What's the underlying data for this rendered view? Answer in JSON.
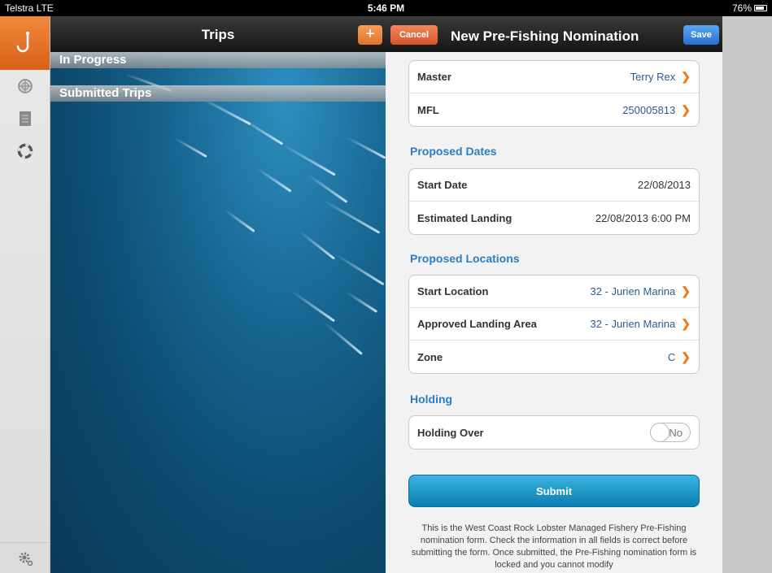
{
  "status_bar": {
    "carrier": "Telstra  LTE",
    "time": "5:46 PM",
    "battery": "76%"
  },
  "rail": {
    "items": [
      {
        "icon": "hook-icon"
      },
      {
        "icon": "radar-icon"
      },
      {
        "icon": "document-icon"
      },
      {
        "icon": "lifebuoy-icon"
      }
    ],
    "settings_icon": "gear-icon"
  },
  "trips_panel": {
    "title": "Trips",
    "add_label": "+",
    "sections": [
      "In Progress",
      "Submitted Trips"
    ]
  },
  "form_panel": {
    "cancel_label": "Cancel",
    "title": "New Pre-Fishing Nomination",
    "save_label": "Save",
    "vessel_rows": [
      {
        "label": "Master",
        "value": "Terry Rex"
      },
      {
        "label": "MFL",
        "value": "250005813"
      }
    ],
    "proposed_dates": {
      "title": "Proposed Dates",
      "rows": [
        {
          "label": "Start Date",
          "value": "22/08/2013"
        },
        {
          "label": "Estimated Landing",
          "value": "22/08/2013 6:00 PM"
        }
      ]
    },
    "proposed_locations": {
      "title": "Proposed Locations",
      "rows": [
        {
          "label": "Start Location",
          "value": "32 - Jurien Marina"
        },
        {
          "label": "Approved Landing Area",
          "value": "32 - Jurien Marina"
        },
        {
          "label": "Zone",
          "value": "C"
        }
      ]
    },
    "holding": {
      "title": "Holding",
      "label": "Holding Over",
      "toggle_value": "No"
    },
    "submit_label": "Submit",
    "note": "This is the West Coast Rock Lobster Managed Fishery Pre-Fishing nomination form. Check the information in all fields is correct before submitting the form. Once submitted, the Pre-Fishing nomination form is locked and you cannot modify"
  },
  "colors": {
    "accent_orange": "#e0742c",
    "link_blue": "#2a7ec6",
    "submit_blue": "#1a95c6"
  }
}
